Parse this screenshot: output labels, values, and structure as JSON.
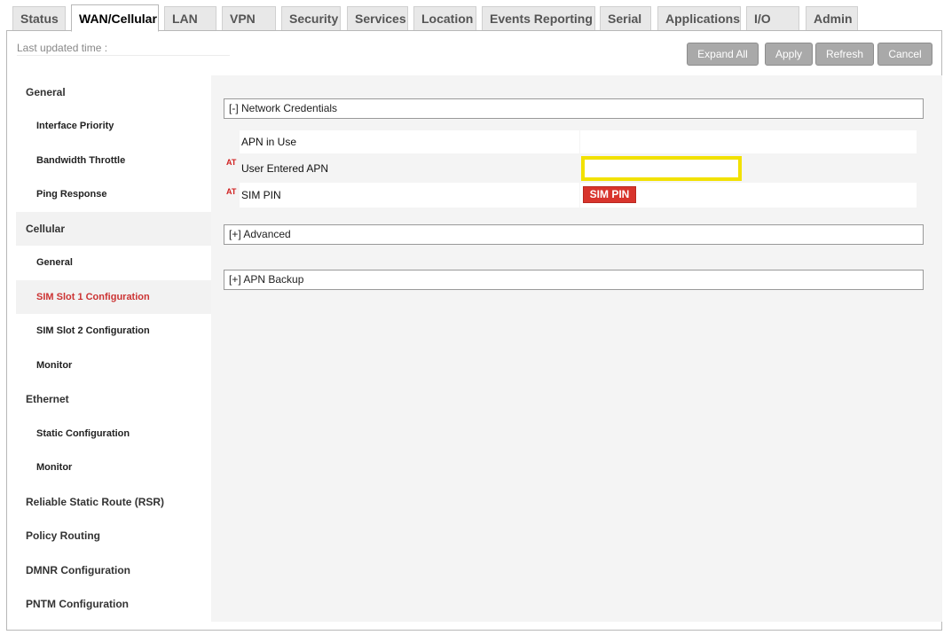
{
  "tabs": [
    {
      "label": "Status"
    },
    {
      "label": "WAN/Cellular"
    },
    {
      "label": "LAN"
    },
    {
      "label": "VPN"
    },
    {
      "label": "Security"
    },
    {
      "label": "Services"
    },
    {
      "label": "Location"
    },
    {
      "label": "Events Reporting"
    },
    {
      "label": "Serial"
    },
    {
      "label": "Applications"
    },
    {
      "label": "I/O"
    },
    {
      "label": "Admin"
    }
  ],
  "active_tab": "WAN/Cellular",
  "header": {
    "last_updated_label": "Last updated time :"
  },
  "toolbar": {
    "expand_all": "Expand All",
    "apply": "Apply",
    "refresh": "Refresh",
    "cancel": "Cancel"
  },
  "sidebar": {
    "items": [
      {
        "label": "General"
      },
      {
        "label": "Interface Priority"
      },
      {
        "label": "Bandwidth Throttle"
      },
      {
        "label": "Ping Response"
      },
      {
        "label": "Cellular"
      },
      {
        "label": "General"
      },
      {
        "label": "SIM Slot 1 Configuration"
      },
      {
        "label": "SIM Slot 2 Configuration"
      },
      {
        "label": "Monitor"
      },
      {
        "label": "Ethernet"
      },
      {
        "label": "Static Configuration"
      },
      {
        "label": "Monitor"
      },
      {
        "label": "Reliable Static Route (RSR)"
      },
      {
        "label": "Policy Routing"
      },
      {
        "label": "DMNR Configuration"
      },
      {
        "label": "PNTM Configuration"
      }
    ],
    "selected": "SIM Slot 1 Configuration"
  },
  "main": {
    "network_credentials": {
      "header": "[-] Network Credentials",
      "apn_in_use_label": "APN in Use",
      "apn_in_use_value": "",
      "user_apn_marker": "AT",
      "user_apn_label": "User Entered APN",
      "user_apn_value": "",
      "sim_pin_marker": "AT",
      "sim_pin_label": "SIM PIN",
      "sim_pin_button": "SIM PIN"
    },
    "advanced_header": "[+] Advanced",
    "apn_backup_header": "[+] APN Backup"
  },
  "colors": {
    "accent_red": "#d8342c",
    "highlight_yellow": "#f2e100",
    "button_gray": "#a9a9a9",
    "panel_gray": "#f4f4f4"
  }
}
